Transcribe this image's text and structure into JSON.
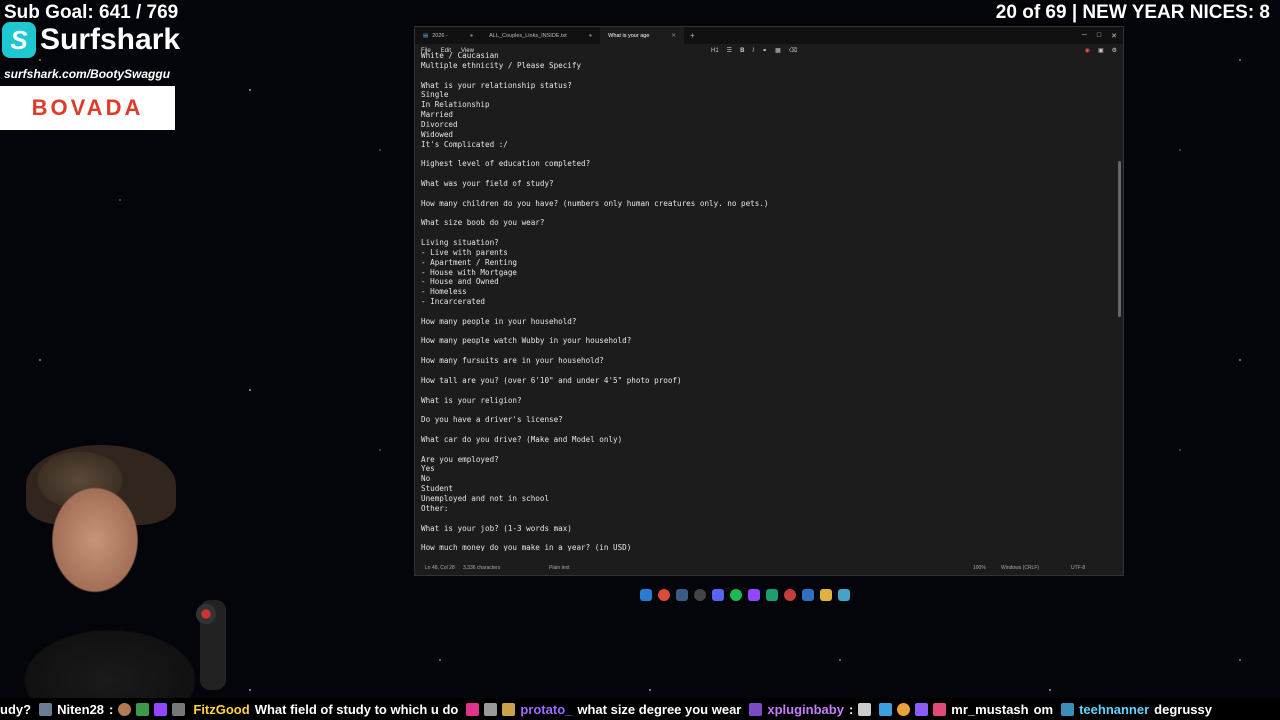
{
  "overlay": {
    "sub_goal": "Sub Goal: 641 / 769",
    "sponsor_name": "Surfshark",
    "sponsor_url": "surfshark.com/BootySwaggu",
    "sponsor2": "BOVADA",
    "counter": "20 of 69 | NEW YEAR NICES: 8"
  },
  "window": {
    "tabs": [
      {
        "label": "2026 -",
        "active": false
      },
      {
        "label": "ALL_Couples_Links_INSIDE.txt",
        "active": false
      },
      {
        "label": "What is your age",
        "active": true
      }
    ],
    "menu": [
      "File",
      "Edit",
      "View"
    ],
    "format_heading": "H1",
    "lines": [
      "White / Caucasian",
      "Multiple ethnicity / Please Specify",
      "",
      "What is your relationship status?",
      "Single",
      "In Relationship",
      "Married",
      "Divorced",
      "Widowed",
      "It's Complicated :/",
      "",
      "Highest level of education completed?",
      "",
      "What was your field of study?",
      "",
      "How many children do you have? (numbers only human creatures only. no pets.)",
      "",
      "What size boob do you wear?",
      "",
      "Living situation?",
      "- Live with parents",
      "- Apartment / Renting",
      "- House with Mortgage",
      "- House and Owned",
      "- Homeless",
      "- Incarcerated",
      "",
      "How many people in your household?",
      "",
      "How many people watch Wubby in your household?",
      "",
      "How many fursuits are in your household?",
      "",
      "How tall are you? (over 6'10\" and under 4'5\" photo proof)",
      "",
      "What is your religion?",
      "",
      "Do you have a driver's license?",
      "",
      "What car do you drive? (Make and Model only)",
      "",
      "Are you employed?",
      "Yes",
      "No",
      "Student",
      "Unemployed and not in school",
      "Other:",
      "",
      "What is your job? (1-3 words max)",
      "",
      "How much money do you make in a year? (in USD)"
    ],
    "status": {
      "position": "Ln 48, Col 28",
      "chars": "3,336 characters",
      "mode": "Plain text",
      "zoom": "100%",
      "line_ending": "Windows (CRLF)",
      "encoding": "UTF-8"
    }
  },
  "ticker": [
    {
      "user": "",
      "msg": "udy?"
    },
    {
      "user": "Niten28",
      "msg": ":"
    },
    {
      "user": "FitzGood",
      "msg": "What field of study to which u do"
    },
    {
      "user": "protato_",
      "msg": "what size degree you wear"
    },
    {
      "user": "xpluginbaby",
      "msg": ":"
    },
    {
      "user": "mr_mustash",
      "msg": "om"
    },
    {
      "user": "teehnanner",
      "msg": "degrussy"
    }
  ],
  "colors": {
    "surfshark": "#1ec8d0",
    "bovada": "#e03a2b",
    "editor_bg": "#1c1c1c"
  }
}
